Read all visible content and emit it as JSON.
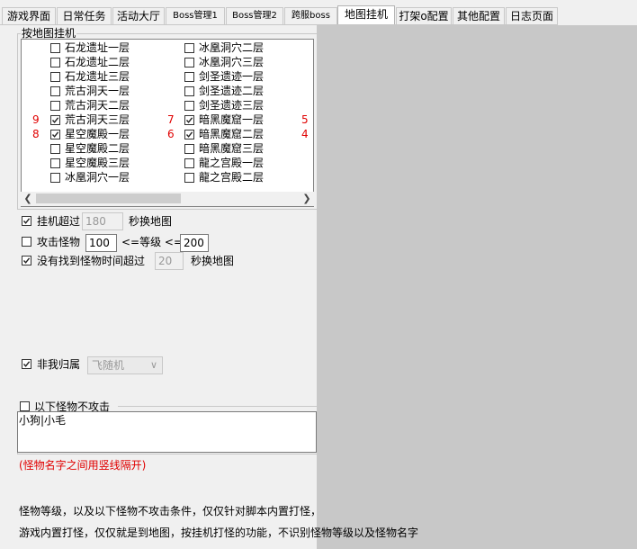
{
  "tabs": [
    {
      "label": "游戏界面",
      "active": false
    },
    {
      "label": "日常任务",
      "active": false
    },
    {
      "label": "活动大厅",
      "active": false
    },
    {
      "label": "Boss管理1",
      "active": false
    },
    {
      "label": "Boss管理2",
      "active": false
    },
    {
      "label": "跨服boss",
      "active": false
    },
    {
      "label": "地图挂机",
      "active": true
    },
    {
      "label": "打架o配置",
      "active": false
    },
    {
      "label": "其他配置",
      "active": false
    },
    {
      "label": "日志页面",
      "active": false
    }
  ],
  "map_group": {
    "title": "按地图挂机",
    "left_column": [
      {
        "label": "石龙遗址一层",
        "checked": false,
        "order": ""
      },
      {
        "label": "石龙遗址二层",
        "checked": false,
        "order": ""
      },
      {
        "label": "石龙遗址三层",
        "checked": false,
        "order": ""
      },
      {
        "label": "荒古洞天一层",
        "checked": false,
        "order": ""
      },
      {
        "label": "荒古洞天二层",
        "checked": false,
        "order": ""
      },
      {
        "label": "荒古洞天三层",
        "checked": true,
        "order": "9"
      },
      {
        "label": "星空魔殿一层",
        "checked": true,
        "order": "8"
      },
      {
        "label": "星空魔殿二层",
        "checked": false,
        "order": ""
      },
      {
        "label": "星空魔殿三层",
        "checked": false,
        "order": ""
      },
      {
        "label": "冰凰洞穴一层",
        "checked": false,
        "order": ""
      }
    ],
    "right_column": [
      {
        "label": "冰凰洞穴二层",
        "checked": false,
        "order": ""
      },
      {
        "label": "冰凰洞穴三层",
        "checked": false,
        "order": ""
      },
      {
        "label": "剑圣遗迹一层",
        "checked": false,
        "order": ""
      },
      {
        "label": "剑圣遗迹二层",
        "checked": false,
        "order": ""
      },
      {
        "label": "剑圣遗迹三层",
        "checked": false,
        "order": ""
      },
      {
        "label": "暗黑魔窟一层",
        "checked": true,
        "order": "7"
      },
      {
        "label": "暗黑魔窟二层",
        "checked": true,
        "order": "6"
      },
      {
        "label": "暗黑魔窟三层",
        "checked": false,
        "order": ""
      },
      {
        "label": "龍之宫殿一层",
        "checked": false,
        "order": ""
      },
      {
        "label": "龍之宫殿二层",
        "checked": false,
        "order": ""
      }
    ],
    "third_column_numbers": [
      "5",
      "4"
    ]
  },
  "settings": {
    "hang_over": {
      "label": "挂机超过",
      "value": "180",
      "suffix": "秒换地图",
      "checked": true
    },
    "attack_monster": {
      "label": "攻击怪物",
      "min": "100",
      "mid": "<=等级 <=",
      "max": "200",
      "checked": false
    },
    "no_monster": {
      "label": "没有找到怪物时间超过",
      "value": "20",
      "suffix": "秒换地图",
      "checked": true
    },
    "not_mine": {
      "label": "非我归属",
      "checked": true,
      "select_value": "飞随机"
    }
  },
  "exclude": {
    "title": "以下怪物不攻击",
    "checked": false,
    "text": "小狗|小毛",
    "hint": "(怪物名字之间用竖线隔开)"
  },
  "notes": {
    "line1": "怪物等级，以及以下怪物不攻击条件，仅仅针对脚本内置打怪，",
    "line2": "游戏内置打怪，仅仅就是到地图，按挂机打怪的功能，不识别怪物等级以及怪物名字"
  },
  "colors": {
    "accent_red": "#e00000",
    "right_pane": "#c8c8c8"
  }
}
